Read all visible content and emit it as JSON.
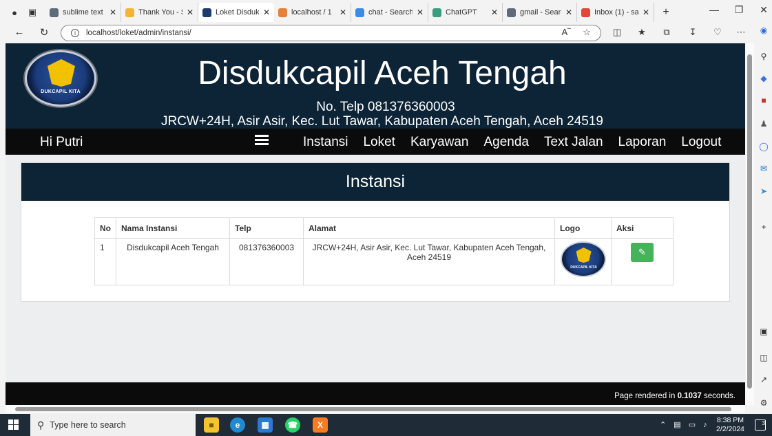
{
  "browser": {
    "tabs": [
      {
        "label": "sublime text",
        "color": "#5f6b7a",
        "active": false
      },
      {
        "label": "Thank You - S",
        "color": "#f2b531",
        "active": false
      },
      {
        "label": "Loket Disduk",
        "color": "#1d3c6e",
        "active": true
      },
      {
        "label": "localhost / 1",
        "color": "#e8803a",
        "active": false
      },
      {
        "label": "chat - Search",
        "color": "#3b8de3",
        "active": false
      },
      {
        "label": "ChatGPT",
        "color": "#3a9d7f",
        "active": false
      },
      {
        "label": "gmail - Searc",
        "color": "#5f6b7a",
        "active": false
      },
      {
        "label": "Inbox (1) - sa",
        "color": "#e2463d",
        "active": false
      }
    ],
    "url": "localhost/loket/admin/instansi/",
    "new_tab_symbol": "+"
  },
  "header": {
    "title": "Disdukcapil Aceh Tengah",
    "phone": "No. Telp 081376360003",
    "address": "JRCW+24H, Asir Asir, Kec. Lut Tawar, Kabupaten Aceh Tengah, Aceh 24519",
    "logo_text": "DUKCAPIL KITA"
  },
  "nav": {
    "greeting": "Hi Putri",
    "links": [
      "Instansi",
      "Loket",
      "Karyawan",
      "Agenda",
      "Text Jalan",
      "Laporan",
      "Logout"
    ]
  },
  "card": {
    "title": "Instansi",
    "columns": [
      "No",
      "Nama Instansi",
      "Telp",
      "Alamat",
      "Logo",
      "Aksi"
    ],
    "rows": [
      {
        "no": "1",
        "nama": "Disdukcapil Aceh Tengah",
        "telp": "081376360003",
        "alamat": "JRCW+24H, Asir Asir, Kec. Lut Tawar, Kabupaten Aceh Tengah, Aceh 24519",
        "logo_text": "DUKCAPIL KITA",
        "action_icon": "pencil-icon"
      }
    ]
  },
  "footer": {
    "prefix": "Page rendered in ",
    "time": "0.1037",
    "suffix": " seconds."
  },
  "taskbar": {
    "search_placeholder": "Type here to search",
    "time": "8:38 PM",
    "date": "2/2/2024",
    "notification_count": "3"
  },
  "colors": {
    "header_bg": "#0d2436",
    "nav_bg": "#0b0b0b",
    "edit_button": "#45b35a"
  }
}
